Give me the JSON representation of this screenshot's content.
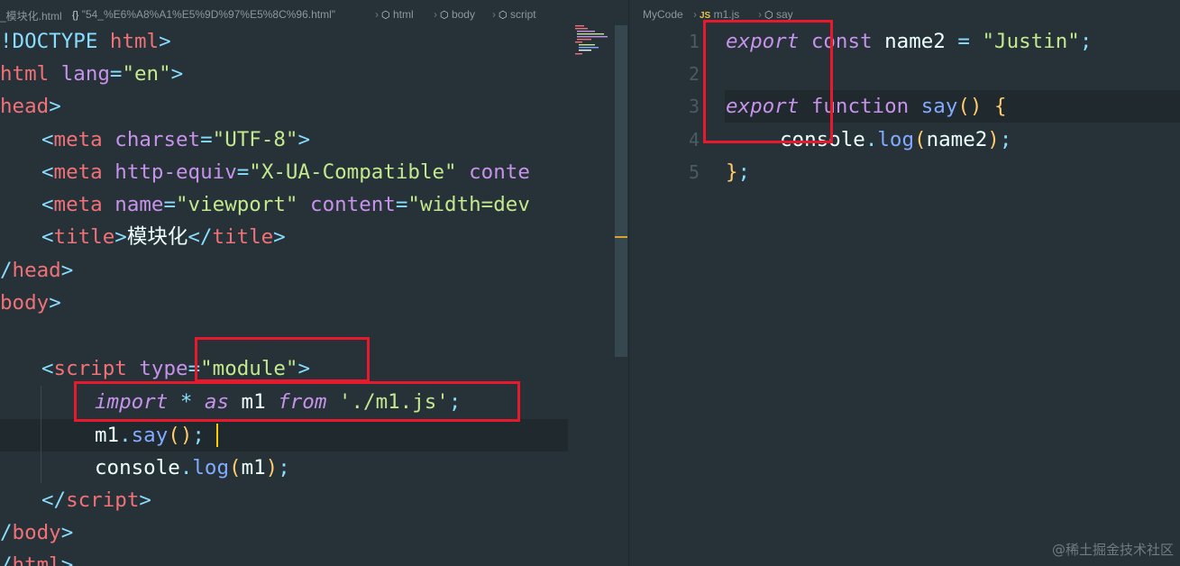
{
  "left_breadcrumb": {
    "file": "_模块化.html",
    "path": "\"54_%E6%A8%A1%E5%9D%97%E5%8C%96.html\"",
    "html": "html",
    "body": "body",
    "script": "script"
  },
  "right_breadcrumb": {
    "folder": "MyCode",
    "js_badge": "JS",
    "file": "m1.js",
    "symbol": "say"
  },
  "html_code": {
    "l1_a": "!DOCTYPE",
    "l1_b": " html",
    "l1_c": ">",
    "l2_a": "html",
    "l2_b": " lang",
    "l2_c": "=",
    "l2_d": "\"en\"",
    "l2_e": ">",
    "l3_a": "head",
    "l3_b": ">",
    "l4_a": "<",
    "l4_b": "meta",
    "l4_c": " charset",
    "l4_d": "=",
    "l4_e": "\"UTF-8\"",
    "l4_f": ">",
    "l5_a": "<",
    "l5_b": "meta",
    "l5_c": " http-equiv",
    "l5_d": "=",
    "l5_e": "\"X-UA-Compatible\"",
    "l5_f": " conte",
    "l6_a": "<",
    "l6_b": "meta",
    "l6_c": " name",
    "l6_d": "=",
    "l6_e": "\"viewport\"",
    "l6_f": " content",
    "l6_g": "=",
    "l6_h": "\"width=dev",
    "l7_a": "<",
    "l7_b": "title",
    "l7_c": ">",
    "l7_d": "模块化",
    "l7_e": "</",
    "l7_f": "title",
    "l7_g": ">",
    "l8_a": "/",
    "l8_b": "head",
    "l8_c": ">",
    "l9_a": "body",
    "l9_b": ">",
    "l11_a": "<",
    "l11_b": "script",
    "l11_c": " type",
    "l11_d": "=",
    "l11_e": "\"module\"",
    "l11_f": ">",
    "l12_a": "import",
    "l12_b": " * ",
    "l12_c": "as",
    "l12_d": " m1 ",
    "l12_e": "from",
    "l12_f": " './m1.js'",
    "l12_g": ";",
    "l13_a": "m1",
    "l13_b": ".",
    "l13_c": "say",
    "l13_d": "()",
    "l13_e": ";",
    "l14_a": "console",
    "l14_b": ".",
    "l14_c": "log",
    "l14_d": "(",
    "l14_e": "m1",
    "l14_f": ")",
    "l14_g": ";",
    "l15_a": "</",
    "l15_b": "script",
    "l15_c": ">",
    "l16_a": "/",
    "l16_b": "body",
    "l16_c": ">",
    "l17_a": "/",
    "l17_b": "html",
    "l17_c": ">"
  },
  "js_code": {
    "gutter": [
      "1",
      "2",
      "3",
      "4",
      "5"
    ],
    "l1_a": "export",
    "l1_b": " const",
    "l1_c": " name2 ",
    "l1_d": "=",
    "l1_e": " \"Justin\"",
    "l1_f": ";",
    "l3_a": "export",
    "l3_b": " function",
    "l3_c": " say",
    "l3_d": "()",
    "l3_e": " {",
    "l4_a": "console",
    "l4_b": ".",
    "l4_c": "log",
    "l4_d": "(",
    "l4_e": "name2",
    "l4_f": ")",
    "l4_g": ";",
    "l5_a": "}",
    "l5_b": ";"
  },
  "watermark": "@稀土掘金技术社区",
  "colors": {
    "background": "#263238",
    "keyword": "#c792ea",
    "string": "#c3e88d",
    "tag": "#f07178",
    "function": "#82aaff",
    "punctuation": "#89ddff",
    "highlight_box": "#e8192c"
  }
}
